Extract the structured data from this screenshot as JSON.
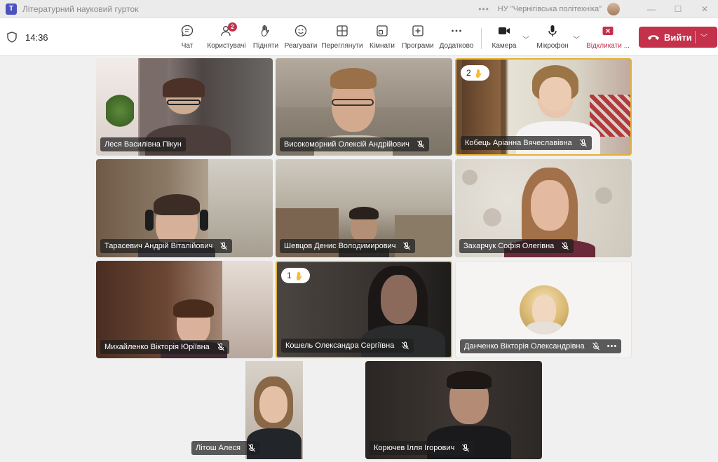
{
  "window": {
    "title": "Літературний науковий гурток",
    "organization": "НУ \"Чернігівська політехніка\""
  },
  "meeting": {
    "time": "14:36"
  },
  "toolbar": {
    "chat": "Чат",
    "people": "Користувачі",
    "people_count": "2",
    "raise_hand": "Підняти",
    "react": "Реагувати",
    "view": "Переглянути",
    "rooms": "Кімнати",
    "apps": "Програми",
    "more": "Додатково",
    "camera": "Камера",
    "mic": "Мікрофон",
    "share": "Відкликати ...",
    "leave": "Вийти"
  },
  "participants": [
    {
      "name": "Леся Василівна Пікун",
      "muted": false,
      "hand": null
    },
    {
      "name": "Високоморний Олексій Андрійович",
      "muted": true,
      "hand": null
    },
    {
      "name": "Кобець Аріанна Вячеславівна",
      "muted": true,
      "hand": "2"
    },
    {
      "name": "Тарасевич Андрій Віталійович",
      "muted": true,
      "hand": null
    },
    {
      "name": "Шевцов Денис Володимирович",
      "muted": true,
      "hand": null
    },
    {
      "name": "Захарчук Софія Олегівна",
      "muted": true,
      "hand": null
    },
    {
      "name": "Михайленко Вікторія Юріївна",
      "muted": true,
      "hand": null
    },
    {
      "name": "Кошель Олександра Сергіївна",
      "muted": true,
      "hand": "1"
    },
    {
      "name": "Данченко Вікторія Олександрівна",
      "muted": true,
      "hand": null
    },
    {
      "name": "Літош Алеся",
      "muted": true,
      "hand": null
    },
    {
      "name": "Корючев Ілля Ігорович",
      "muted": true,
      "hand": null
    }
  ],
  "colors": {
    "leave_button": "#c4314b",
    "hand_highlight": "#e3b236",
    "share_text": "#c4314b",
    "accent": "#4b53bc"
  }
}
